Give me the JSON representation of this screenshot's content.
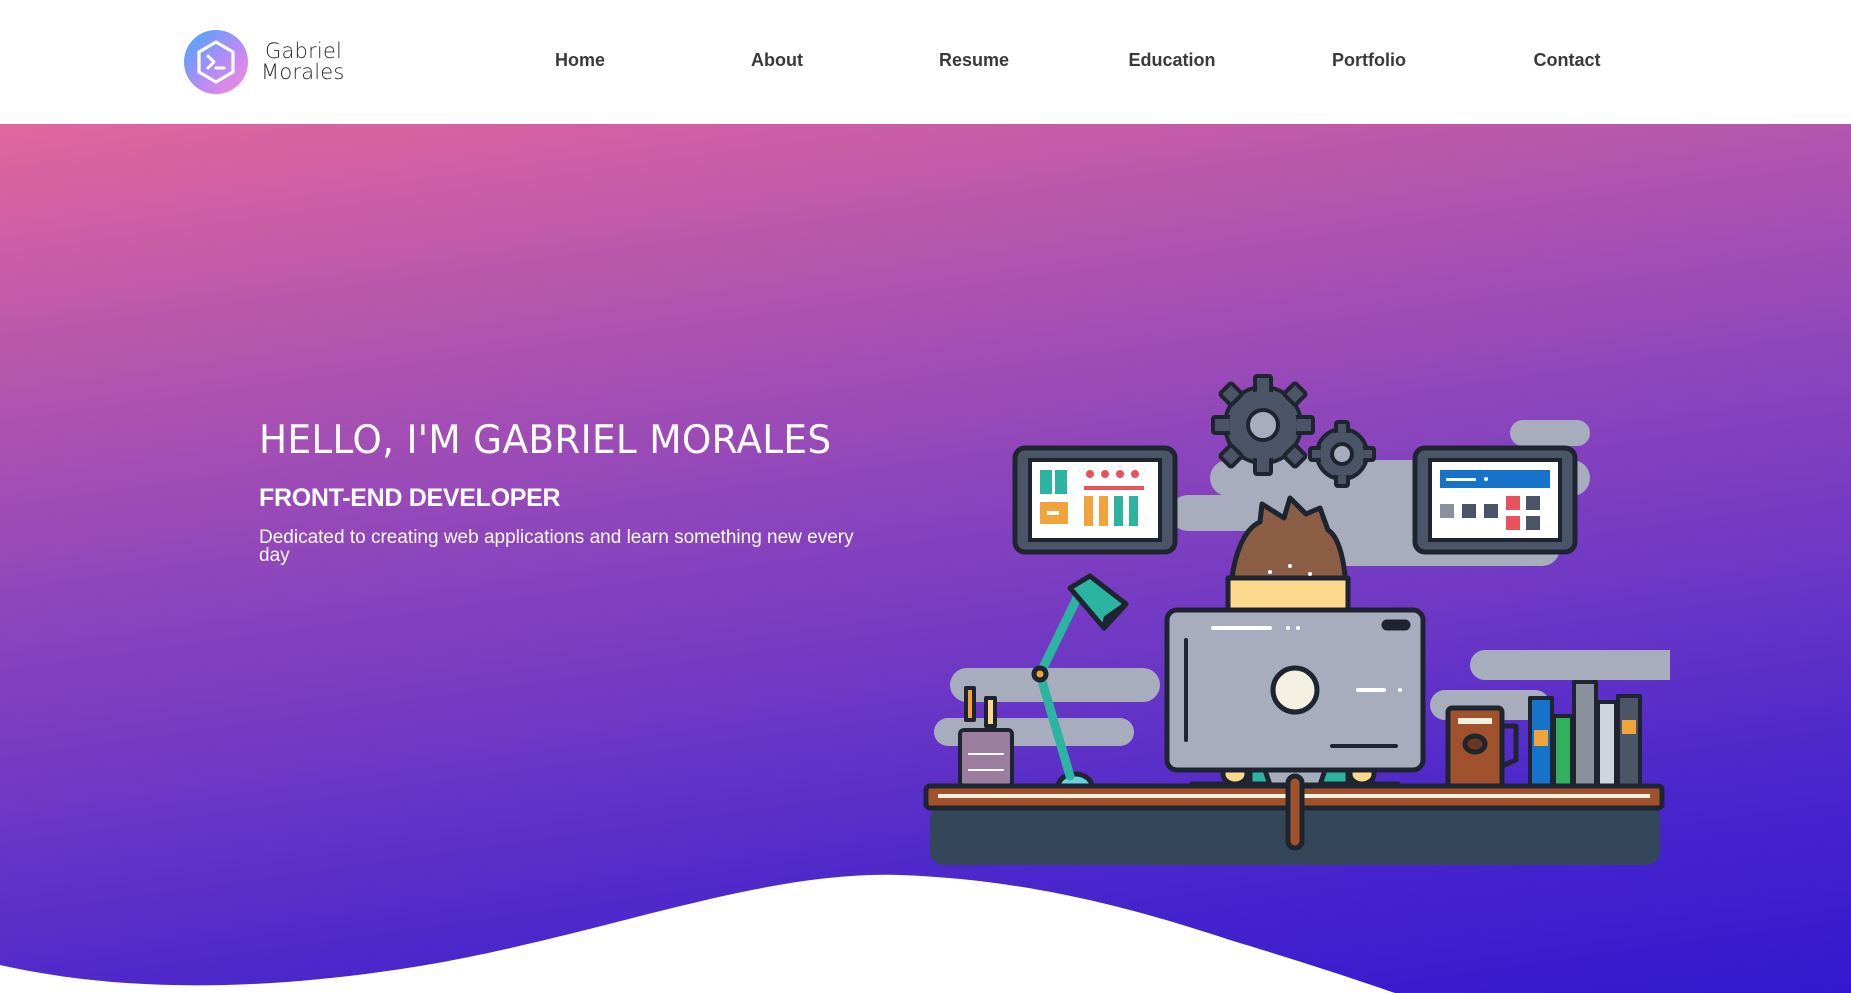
{
  "brand": {
    "line1": "Gabriel",
    "line2": "Morales",
    "icon": "terminal-hexagon-icon",
    "gradient": [
      "#3fa9ff",
      "#b58cf5",
      "#ff86d6"
    ]
  },
  "nav": {
    "items": [
      {
        "label": "Home"
      },
      {
        "label": "About"
      },
      {
        "label": "Resume"
      },
      {
        "label": "Education"
      },
      {
        "label": "Portfolio"
      },
      {
        "label": "Contact"
      }
    ]
  },
  "hero": {
    "title": "HELLO, I'M GABRIEL MORALES",
    "role": "FRONT-END DEVELOPER",
    "description": "Dedicated to creating web applications and learn something new every day",
    "gradient": [
      "#e1669e",
      "#8a44bd",
      "#3318cf"
    ],
    "illustration": "developer-at-desk-illustration"
  }
}
